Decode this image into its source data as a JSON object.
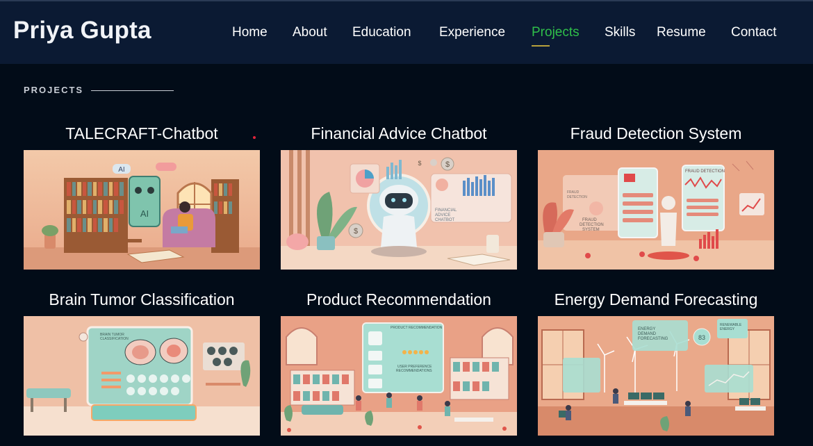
{
  "header": {
    "brand": "Priya Gupta",
    "nav": [
      {
        "label": "Home",
        "active": false
      },
      {
        "label": "About",
        "active": false
      },
      {
        "label": "Education",
        "active": false
      },
      {
        "label": "Experience",
        "active": false
      },
      {
        "label": "Projects",
        "active": true
      },
      {
        "label": "Skills",
        "active": false
      },
      {
        "label": "Resume",
        "active": false
      },
      {
        "label": "Contact",
        "active": false
      }
    ]
  },
  "section": {
    "label": "PROJECTS"
  },
  "projects": [
    {
      "title": "TALECRAFT-Chatbot",
      "image_texts": [
        "AI",
        "AI"
      ]
    },
    {
      "title": "Financial Advice Chatbot",
      "image_texts": [
        "FINANCIAL",
        "ADVICE",
        "CHATBOT",
        "$",
        "$",
        "$"
      ]
    },
    {
      "title": "Fraud Detection System",
      "image_texts": [
        "FRAUD DETECTION",
        "FRAUD",
        "DETECTION",
        "FRAUD",
        "DETECTION",
        "SYSTEM"
      ]
    },
    {
      "title": "Brain Tumor Classification",
      "image_texts": [
        "BRAIN TUMOR",
        "CLASSIFICATION"
      ]
    },
    {
      "title": "Product Recommendation",
      "image_texts": [
        "PRODUCT RECOMMENDATION",
        "USER PREFERENCE",
        "RECOMMENDATIONS"
      ]
    },
    {
      "title": "Energy Demand Forecasting",
      "image_texts": [
        "ENERGY",
        "DEMAND",
        "FORECASTING",
        "RENEWABLE",
        "ENERGY",
        "83"
      ]
    }
  ],
  "colors": {
    "page_bg": "#020c18",
    "header_bg": "#0b1a33",
    "active_nav": "#2fbf4a",
    "underline": "#b9a23c"
  }
}
